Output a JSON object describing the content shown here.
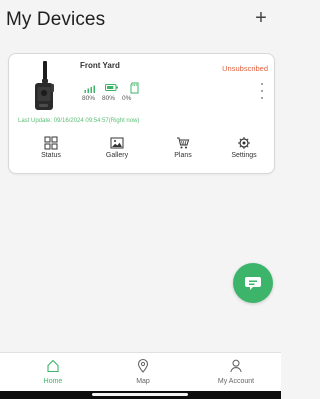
{
  "header": {
    "title": "My Devices",
    "add_label": "+"
  },
  "device": {
    "name": "Front Yard",
    "subscription_status": "Unsubscribed",
    "signal_value": "80%",
    "battery_value": "80%",
    "storage_value": "0%",
    "last_update": "Last Update: 09/16/2024 09:54:57(Right now)",
    "actions": {
      "status": "Status",
      "gallery": "Gallery",
      "plans": "Plans",
      "settings": "Settings"
    }
  },
  "bottom_nav": {
    "home": "Home",
    "map": "Map",
    "account": "My Account"
  },
  "colors": {
    "accent": "#3cb56a",
    "subscription": "#e0613f",
    "last_update": "#5bbf75"
  },
  "icons": {
    "add": "plus-icon",
    "signal": "signal-icon",
    "battery": "battery-icon",
    "storage": "sd-card-icon",
    "status": "grid-icon",
    "gallery": "image-icon",
    "plans": "cart-icon",
    "settings": "gear-icon",
    "chat": "chat-icon",
    "home": "home-icon",
    "map": "map-pin-icon",
    "account": "user-icon"
  }
}
